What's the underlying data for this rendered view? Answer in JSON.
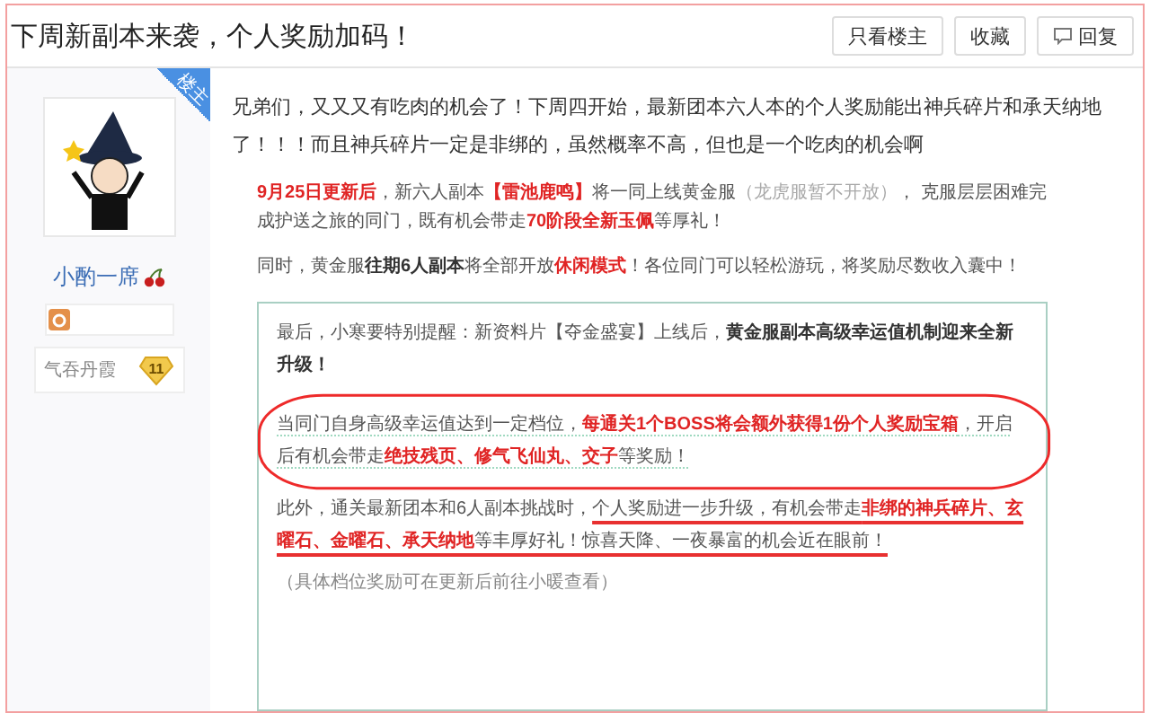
{
  "thread": {
    "title": "下周新副本来袭，个人奖励加码！",
    "buttons": [
      {
        "label": "只看楼主",
        "kind": "text"
      },
      {
        "label": "收藏",
        "kind": "text"
      },
      {
        "label": "回复",
        "kind": "reply"
      }
    ]
  },
  "author": {
    "badge": "楼主",
    "name": "小酌一席",
    "rank": "气吞丹霞",
    "level": "11"
  },
  "post": {
    "intro": "兄弟们，又又又有吃肉的机会了！下周四开始，最新团本六人本的个人奖励能出神兵碎片和承天纳地了！！！而且神兵碎片一定是非绑的，虽然概率不高，但也是一个吃肉的机会啊",
    "image": {
      "paragraphs": [
        [
          {
            "text": "9月25日更新后",
            "kind": "highlight"
          },
          {
            "text": "，新六人副本",
            "kind": "plain"
          },
          {
            "text": "【雷池鹿鸣】",
            "kind": "highlight"
          },
          {
            "text": "将一同上线黄金服",
            "kind": "plain"
          },
          {
            "text": "（龙虎服暂不开放）",
            "kind": "aside"
          },
          {
            "text": "， 克服层层困难完成护送之旅的同门，既有机会带走",
            "kind": "plain"
          },
          {
            "text": "70阶段全新玉佩",
            "kind": "highlight"
          },
          {
            "text": "等厚礼！",
            "kind": "plain"
          }
        ],
        [
          {
            "text": "同时，黄金服",
            "kind": "plain"
          },
          {
            "text": "往期6人副本",
            "kind": "strong"
          },
          {
            "text": "将全部开放",
            "kind": "plain"
          },
          {
            "text": "休闲模式",
            "kind": "highlight"
          },
          {
            "text": "！各位同门可以轻松游玩，将奖励尽数收入囊中！",
            "kind": "plain"
          }
        ]
      ],
      "notice": {
        "paragraphs": [
          {
            "circled": false,
            "dotted_underline": false,
            "segments": [
              {
                "text": "最后，小寒要特别提醒：新资料片【夺金盛宴】上线后，",
                "kind": "plain"
              },
              {
                "text": "黄金服副本高级幸运值机制迎来全新升级！",
                "kind": "strong"
              }
            ]
          },
          {
            "circled": true,
            "dotted_underline": true,
            "segments": [
              {
                "text": "当同门自身高级幸运值达到一定档位，",
                "kind": "plain"
              },
              {
                "text": "每通关1个BOSS将会额外获得1份个人奖励宝箱",
                "kind": "highlight"
              },
              {
                "text": "，开启后有机会带走",
                "kind": "plain"
              },
              {
                "text": "绝技残页、修气飞仙丸、交子",
                "kind": "highlight"
              },
              {
                "text": "等奖励！",
                "kind": "plain"
              }
            ]
          },
          {
            "circled": false,
            "dotted_underline": false,
            "segments": [
              {
                "text": "此外，通关最新团本和6人副本挑战时，",
                "kind": "plain"
              },
              {
                "text": "个人奖励进一步升级，有机会带走",
                "kind": "underlined"
              },
              {
                "text": "非绑的神兵碎片、玄曜石、金曜石、承天纳地",
                "kind": "underlined-highlight"
              },
              {
                "text": "等丰厚好礼！惊喜天降、一夜暴富的机会近在眼前！",
                "kind": "underlined"
              }
            ]
          }
        ],
        "note": "（具体档位奖励可在更新后前往小暖查看）"
      }
    }
  }
}
